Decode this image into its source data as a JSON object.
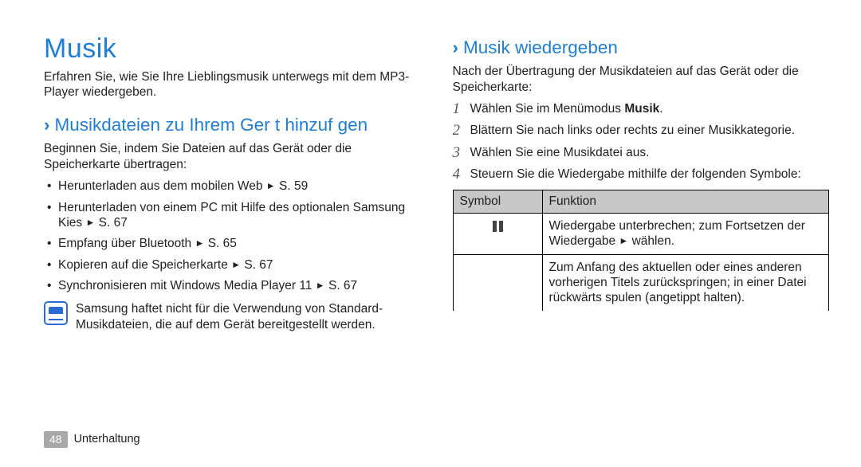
{
  "title": "Musik",
  "intro": "Erfahren Sie, wie Sie Ihre Lieblingsmusik unterwegs mit dem MP3-Player wiedergeben.",
  "left": {
    "subhead": "Musikdateien zu Ihrem Ger t hinzuf gen",
    "lead": "Beginnen Sie, indem Sie Dateien auf das Gerät oder die Speicherkarte übertragen:",
    "bullets": [
      {
        "text": "Herunterladen aus dem mobilen Web",
        "ref": "S. 59"
      },
      {
        "text": "Herunterladen von einem PC mit Hilfe des optionalen Samsung Kies",
        "ref": "S. 67"
      },
      {
        "text": "Empfang über Bluetooth",
        "ref": "S. 65"
      },
      {
        "text": "Kopieren auf die Speicherkarte",
        "ref": "S. 67"
      },
      {
        "text": "Synchronisieren mit Windows Media Player 11",
        "ref": "S. 67"
      }
    ],
    "note": "Samsung haftet nicht für die Verwendung von Standard-Musikdateien, die auf dem Gerät bereitgestellt werden."
  },
  "right": {
    "subhead": "Musik wiedergeben",
    "lead": "Nach der Übertragung der Musikdateien auf das Gerät oder die Speicherkarte:",
    "steps": [
      {
        "pre": "Wählen Sie im Menümodus ",
        "bold": "Musik",
        "post": "."
      },
      {
        "pre": "Blättern Sie nach links oder rechts zu einer Musikkategorie."
      },
      {
        "pre": "Wählen Sie eine Musikdatei aus."
      },
      {
        "pre": "Steuern Sie die Wiedergabe mithilfe der folgenden Symbole:"
      }
    ],
    "table": {
      "headers": [
        "Symbol",
        "Funktion"
      ],
      "rows": [
        {
          "icon": "pause",
          "func_pre": "Wiedergabe unterbrechen; zum Fortsetzen der Wiedergabe ",
          "func_post": " wählen."
        },
        {
          "icon": "",
          "func_pre": "Zum Anfang des aktuellen oder eines anderen vorherigen Titels zurückspringen; in einer Datei rückwärts spulen (angetippt halten).",
          "func_post": ""
        }
      ]
    }
  },
  "footer": {
    "page": "48",
    "section": "Unterhaltung"
  }
}
